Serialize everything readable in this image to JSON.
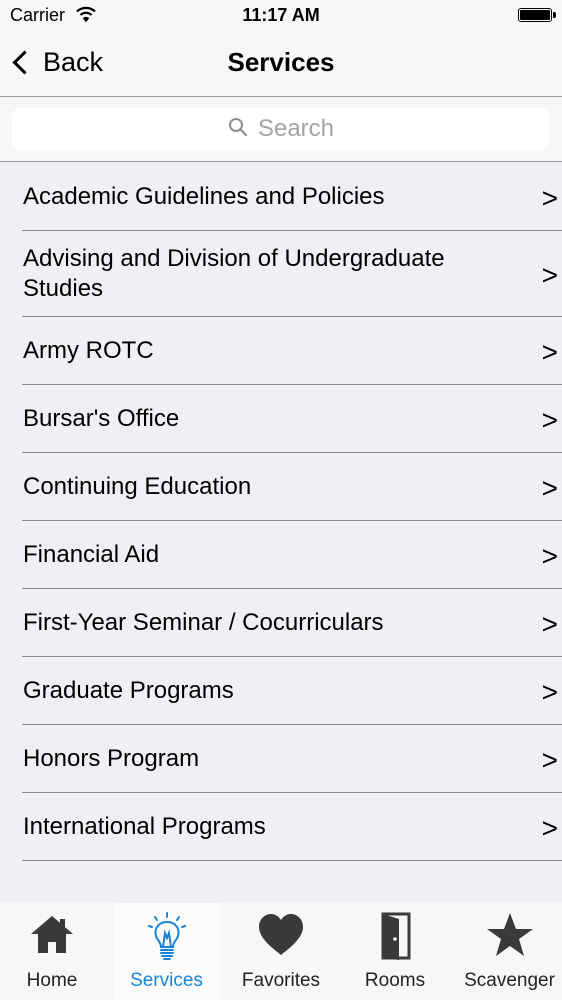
{
  "status_bar": {
    "carrier": "Carrier",
    "time": "11:17 AM",
    "battery_level": 1.0
  },
  "nav_bar": {
    "back_label": "Back",
    "title": "Services"
  },
  "search": {
    "placeholder": "Search"
  },
  "services": [
    {
      "label": "Academic Guidelines and Policies",
      "arrow": ">"
    },
    {
      "label": "Advising and Division of Undergraduate Studies",
      "arrow": ">"
    },
    {
      "label": "Army ROTC",
      "arrow": ">"
    },
    {
      "label": "Bursar's Office",
      "arrow": ">"
    },
    {
      "label": "Continuing Education",
      "arrow": ">"
    },
    {
      "label": "Financial Aid",
      "arrow": ">"
    },
    {
      "label": "First-Year Seminar / Cocurriculars",
      "arrow": ">"
    },
    {
      "label": "Graduate Programs",
      "arrow": ">"
    },
    {
      "label": "Honors Program",
      "arrow": ">"
    },
    {
      "label": "International Programs",
      "arrow": ">"
    }
  ],
  "tab_bar": {
    "accent_color": "#1a83d6",
    "active": "Services",
    "tabs": [
      {
        "label": "Home",
        "icon": "house-icon"
      },
      {
        "label": "Services",
        "icon": "lightbulb-icon"
      },
      {
        "label": "Favorites",
        "icon": "heart-icon"
      },
      {
        "label": "Rooms",
        "icon": "door-icon"
      },
      {
        "label": "Scavenger",
        "icon": "star-icon"
      }
    ]
  }
}
